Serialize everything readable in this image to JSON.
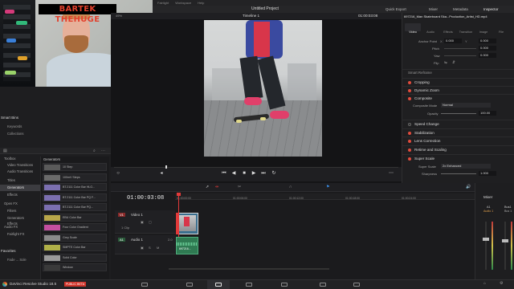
{
  "menubar": {
    "items": [
      "Fairlight",
      "Workspace",
      "Help"
    ]
  },
  "toolbar": {
    "project_title": "Untitled Project",
    "quick_export": "Quick Export",
    "mixer": "Mixer",
    "metadata": "Metadata",
    "inspector": "Inspector"
  },
  "webcam": {
    "banner": "BARTEK THEHUGE"
  },
  "left_panel": {
    "smart_bins_title": "Smart Bins",
    "smart_bins": [
      "Keywords",
      "Collections"
    ],
    "tree": [
      "Toolbox",
      "Video Transitions",
      "Audio Transitions",
      "Titles",
      "Generators",
      "Effects",
      "Open FX",
      "Filters",
      "Generators",
      "Effects",
      "Audio FX",
      "Fairlight FX"
    ],
    "selected_tree_index": 4,
    "favorites_title": "Favorites",
    "favorites": [
      "Fade ... Sole"
    ],
    "generators_title": "Generators",
    "generators": [
      {
        "label": "10 Step",
        "swatch": "#5a5a5a"
      },
      {
        "label": "100mV Steps",
        "swatch": "#6a6a6a"
      },
      {
        "label": "BT.2111 Color Bar HLG...",
        "swatch": "#7b6fb0"
      },
      {
        "label": "BT.2111 Color Bar PQ F...",
        "swatch": "#7b6fb0"
      },
      {
        "label": "BT.2111 Color Bar PQ...",
        "swatch": "#7b6fb0"
      },
      {
        "label": "EBU Color Bar",
        "swatch": "#b8a64a"
      },
      {
        "label": "Four Color Gradient",
        "swatch": "#c44fa0"
      },
      {
        "label": "Grey Scale",
        "swatch": "#8a8a8a"
      },
      {
        "label": "SMPTE Color Bar",
        "swatch": "#b0b048"
      },
      {
        "label": "Solid Color",
        "swatch": "#9a9a9a"
      },
      {
        "label": "Window",
        "swatch": "#3a3a3a"
      }
    ]
  },
  "viewer": {
    "timeline_name": "Timeline 1",
    "timecode": "01:00:03:08",
    "zoom": "49%"
  },
  "inspector": {
    "clip_name": "697216_Man Skateboard Ska...Production_Artist_HD.mp4",
    "tabs": [
      "Video",
      "Audio",
      "Effects",
      "Transition",
      "Image",
      "File"
    ],
    "rows": [
      {
        "label": "Anchor Point",
        "x": "0.000",
        "y": "0.000"
      },
      {
        "label": "Pitch",
        "value": "0.000"
      },
      {
        "label": "Yaw",
        "value": "0.000"
      },
      {
        "label": "Flip",
        "value": ""
      }
    ],
    "smart_reframe": "Smart Reframe",
    "sections": [
      "Cropping",
      "Dynamic Zoom",
      "Composite"
    ],
    "composite_mode_label": "Composite Mode",
    "composite_mode_value": "Normal",
    "opacity_label": "Opacity",
    "opacity_value": "100.00",
    "more_sections": [
      "Speed Change",
      "Stabilization",
      "Lens Correction",
      "Retime and Scaling",
      "Super Scale"
    ],
    "super_scale_label": "Super Scale",
    "super_scale_value": "2x Enhanced",
    "sharpness_label": "Sharpness",
    "sharpness_value": "1.000"
  },
  "timeline": {
    "timecode": "01:00:03:08",
    "ruler": [
      "01:00:00:00",
      "01:00:06:00",
      "01:00:12:00",
      "01:00:18:00",
      "01:00:24:00"
    ],
    "video_track": {
      "id": "V1",
      "name": "Video 1",
      "info": "1 Clip"
    },
    "audio_track": {
      "id": "A1",
      "name": "Audio 1",
      "level": "2.0"
    },
    "audio_clip_label": "697216..."
  },
  "mixer": {
    "title": "Mixer",
    "channels": [
      "A1",
      "Bus1"
    ],
    "channel_names": [
      "Audio 1",
      "Bus 1"
    ]
  },
  "status": {
    "app_name": "DaVinci Resolve Studio 18.5",
    "beta_badge": "PUBLIC BETA"
  }
}
